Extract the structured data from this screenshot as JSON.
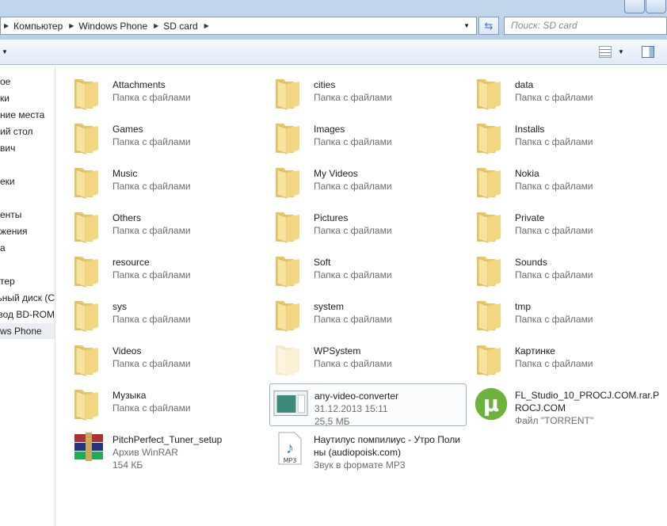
{
  "address": {
    "crumbs": [
      "Компьютер",
      "Windows Phone",
      "SD card"
    ],
    "search_placeholder": "Поиск: SD card"
  },
  "nav": [
    "ое",
    "ки",
    "ние места",
    "ий стол",
    "вич",
    "",
    "еки",
    "",
    "енты",
    "жения",
    "а",
    "",
    "тер",
    "ьный диск (C",
    "вод BD-ROM",
    "ws Phone"
  ],
  "folder_type": "Папка с файлами",
  "items": [
    {
      "name": "Attachments",
      "kind": "folder"
    },
    {
      "name": "cities",
      "kind": "folder"
    },
    {
      "name": "data",
      "kind": "folder"
    },
    {
      "name": "Games",
      "kind": "folder"
    },
    {
      "name": "Images",
      "kind": "folder"
    },
    {
      "name": "Installs",
      "kind": "folder"
    },
    {
      "name": "Music",
      "kind": "folder"
    },
    {
      "name": "My Videos",
      "kind": "folder"
    },
    {
      "name": "Nokia",
      "kind": "folder"
    },
    {
      "name": "Others",
      "kind": "folder"
    },
    {
      "name": "Pictures",
      "kind": "folder"
    },
    {
      "name": "Private",
      "kind": "folder"
    },
    {
      "name": "resource",
      "kind": "folder"
    },
    {
      "name": "Soft",
      "kind": "folder"
    },
    {
      "name": "Sounds",
      "kind": "folder"
    },
    {
      "name": "sys",
      "kind": "folder"
    },
    {
      "name": "system",
      "kind": "folder"
    },
    {
      "name": "tmp",
      "kind": "folder"
    },
    {
      "name": "Videos",
      "kind": "folder"
    },
    {
      "name": "WPSystem",
      "kind": "folder",
      "hidden": true
    },
    {
      "name": "Картинке",
      "kind": "folder"
    },
    {
      "name": "Музыка",
      "kind": "folder"
    },
    {
      "name": "any-video-converter",
      "kind": "exe",
      "lines": [
        "31.12.2013 15:11",
        "25,5 МБ"
      ],
      "selected": true
    },
    {
      "name": "FL_Studio_10_PROCJ.COM.rar.PROCJ.COM",
      "kind": "torrent",
      "lines": [
        "Файл \"TORRENT\""
      ]
    },
    {
      "name": "PitchPerfect_Tuner_setup",
      "kind": "rar",
      "lines": [
        "Архив WinRAR",
        "154 КБ"
      ]
    },
    {
      "name": "Наутилус помпилиус - Утро Полины (audiopoisk.com)",
      "kind": "mp3",
      "lines": [
        "Звук в формате MP3"
      ]
    }
  ]
}
